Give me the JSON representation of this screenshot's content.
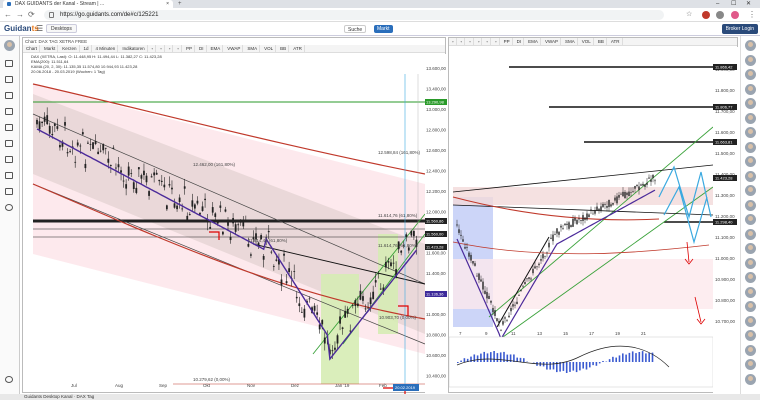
{
  "browser": {
    "tab_title": "DAX GUIDANTS der Kanal - Stream | ...",
    "new_tab": "+",
    "url": "https://go.guidants.com/de#c/125221",
    "win_min": "–",
    "win_max": "☐",
    "win_close": "✕",
    "back": "←",
    "forward": "→",
    "reload": "⟳",
    "star": "☆"
  },
  "app": {
    "logo_text": "Guidan",
    "logo_accent": "ts",
    "desktop_tab": "Desktops",
    "search_label": "Suche",
    "markt_label": "Markt",
    "broker_label": "Broker Login"
  },
  "left_chart": {
    "title": "Chart: DAX TAG XETRA FREE",
    "toolbar": [
      "Chart",
      "Markt",
      "Kerzen",
      "1d",
      "4 Minuten",
      "Indikatoren",
      "",
      "",
      "",
      "",
      "PP",
      "DI",
      "EMA",
      "VWAP",
      "SMA",
      "VOL",
      "BB",
      "ATR"
    ],
    "stats_1": "DAX (XETRA, Last): O: 11.448,95  H: 11.494,44  L: 11.382,27  C: 11.423,28",
    "stats_2": "EMA(200): 11.511,64",
    "stats_3": "KAMA (20, 2, 30): 11.135,35  11.574,80  10.944,93  11.423,28",
    "stats_4": "20.06.2018 - 20.03.2019 (Wochen: 1 Tag)",
    "y_ticks": [
      "13.600,00",
      "13.400,00",
      "13.000,00",
      "12.800,00",
      "12.600,00",
      "12.400,00",
      "12.200,00",
      "12.000,00",
      "11.800,00",
      "11.600,00",
      "11.400,00",
      "11.200,00",
      "11.000,00",
      "10.800,00",
      "10.600,00",
      "10.400,00"
    ],
    "x_ticks": [
      "Jul",
      "Aug",
      "Sep",
      "Okt",
      "Nov",
      "Dez",
      "Jan '19",
      "Feb"
    ],
    "date_tag": "20.02.2019",
    "annotations": [
      "12.598,84 (161,80%)",
      "12.462,00 (161,80%)",
      "11.614,76 (61,80%)",
      "11.614,48 (61,80%)",
      "11.614,76 (61,80%)",
      "10.903,70 (0,00%)",
      "10.279,62 (0,00%)"
    ],
    "price_tags": [
      {
        "text": "13.290,98",
        "color": "#2a9a2a"
      },
      {
        "text": "11.560,86",
        "color": "#222222"
      },
      {
        "text": "11.560,00",
        "color": "#222222"
      },
      {
        "text": "11.423,28",
        "color": "#222222"
      },
      {
        "text": "11.136,36",
        "color": "#3d2a9a"
      }
    ]
  },
  "right_chart": {
    "toolbar": [
      "",
      "",
      "",
      "",
      "",
      "",
      "PP",
      "DI",
      "EMA",
      "VWAP",
      "SMA",
      "VOL",
      "BB",
      "ATR"
    ],
    "y_ticks": [
      "11.900,00",
      "11.800,00",
      "11.700,00",
      "11.600,00",
      "11.500,00",
      "11.400,00",
      "11.300,00",
      "11.200,00",
      "11.100,00",
      "11.000,00",
      "10.900,00",
      "10.800,00",
      "10.700,00"
    ],
    "x_ticks": [
      "7",
      "9",
      "11",
      "13",
      "15",
      "17",
      "19",
      "21"
    ],
    "price_tags": [
      {
        "text": "11.866,42",
        "color": "#222222"
      },
      {
        "text": "11.806,77",
        "color": "#222222"
      },
      {
        "text": "11.663,81",
        "color": "#222222"
      },
      {
        "text": "11.423,28",
        "color": "#222222"
      },
      {
        "text": "11.298,40",
        "color": "#222222"
      }
    ]
  },
  "status": {
    "text": "Guidants Desktop Kanal · DAX Tag"
  },
  "colors": {
    "channel_fill": "#e8d6d6",
    "pink_fill": "#fde3e8",
    "green_fill": "#d6ecb4",
    "blue_fill": "#c7d0f7",
    "candle": "#222222",
    "kama": "#4b2a9a",
    "ema": "#c0392b",
    "up_line": "#3aa23a",
    "projection": "#3aa9e0"
  }
}
